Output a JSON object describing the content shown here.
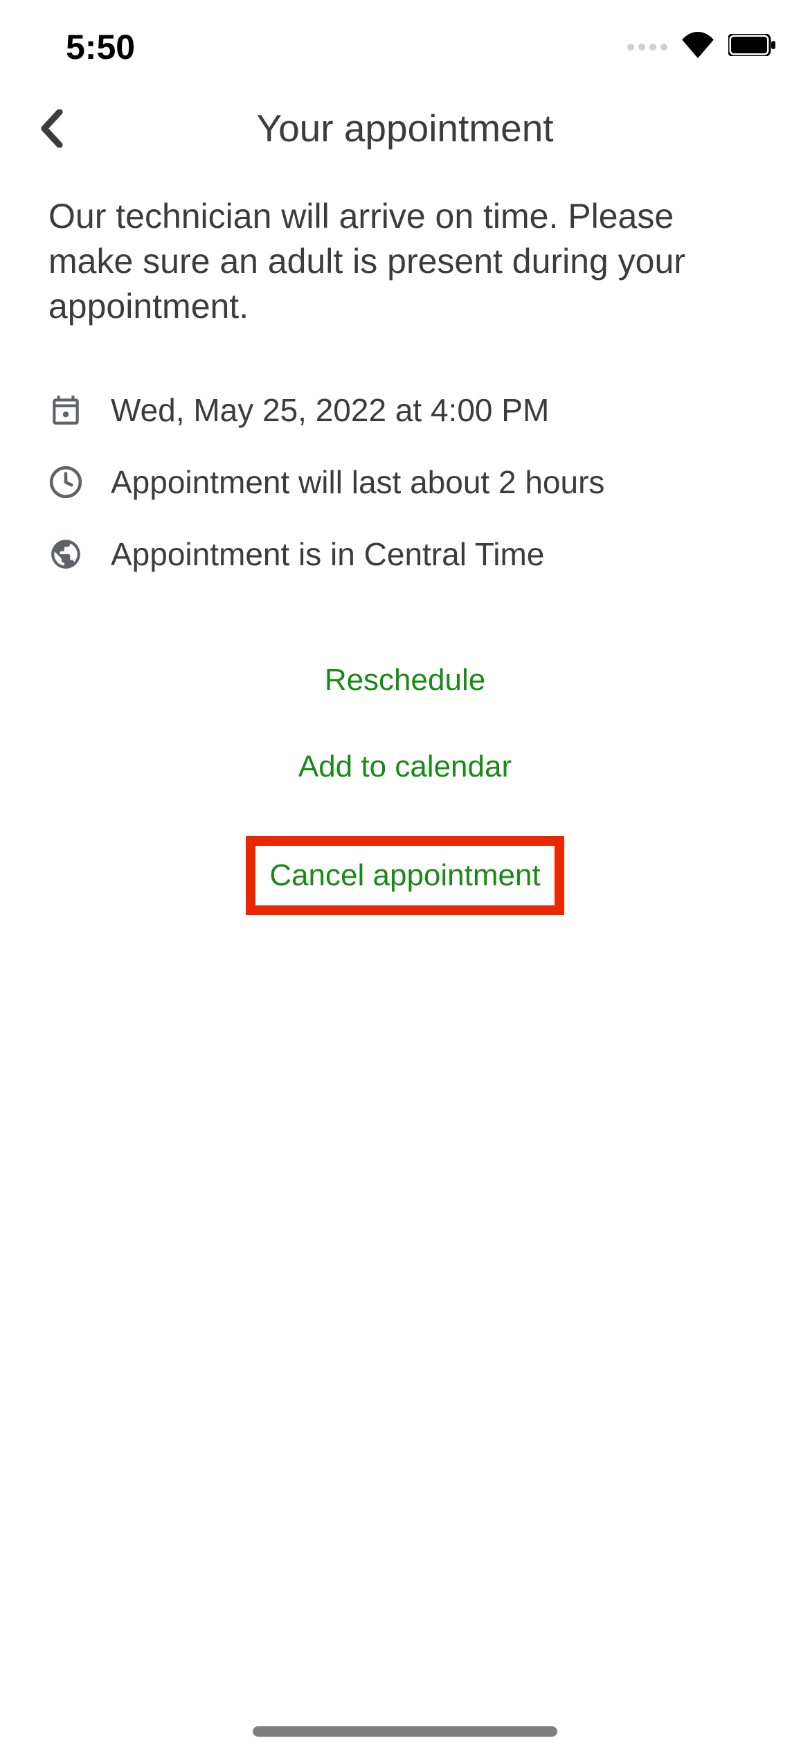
{
  "status_bar": {
    "time": "5:50"
  },
  "header": {
    "title": "Your appointment"
  },
  "content": {
    "description": "Our technician will arrive on time. Please make sure an adult is present during your appointment.",
    "datetime": "Wed, May 25, 2022 at 4:00 PM",
    "duration": "Appointment will last about 2 hours",
    "timezone": "Appointment is in Central Time"
  },
  "actions": {
    "reschedule": "Reschedule",
    "add_to_calendar": "Add to calendar",
    "cancel": "Cancel appointment"
  }
}
